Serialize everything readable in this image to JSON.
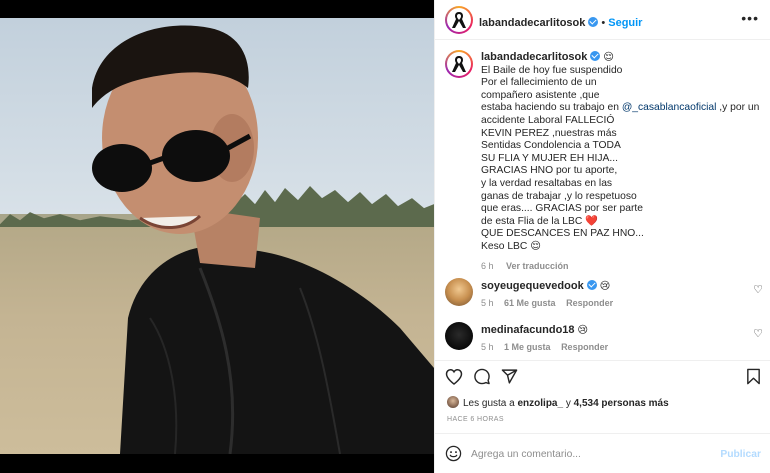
{
  "post": {
    "author": "labandadecarlitosok",
    "follow_label": "Seguir",
    "more_label": "•••",
    "caption_emoji": "😌",
    "caption_lines": [
      "El Baile de hoy fue suspendido",
      "Por el fallecimiento de un",
      "compañero asistente ,que",
      "estaba haciendo su trabajo en ",
      "accidente Laboral FALLECIÓ",
      "KEVIN PEREZ ,nuestras más",
      "Sentidas Condolencia a TODA",
      "SU FLIA Y MUJER EH HIJA...",
      "GRACIAS HNO por tu aporte,",
      "y la verdad resaltabas en las",
      "ganas de trabajar ,y lo respetuoso",
      "que eras.... GRACIAS por ser parte",
      "de esta Flia de la LBC ❤️",
      "QUE DESCANCES EN PAZ HNO...",
      "Keso LBC 😌"
    ],
    "caption_mention": "@_casablancaoficial",
    "caption_after_mention": " ,y por un",
    "caption_time": "6 h",
    "translate_label": "Ver traducción"
  },
  "comments": [
    {
      "user": "soyeugequevedook",
      "verified": true,
      "text": "😢",
      "time": "5 h",
      "likes": "61 Me gusta",
      "reply": "Responder"
    },
    {
      "user": "medinafacundo18",
      "verified": false,
      "text": "😢",
      "time": "5 h",
      "likes": "1 Me gusta",
      "reply": "Responder"
    }
  ],
  "likes": {
    "prefix": "Les gusta a ",
    "user": "enzolipa_",
    "middle": " y ",
    "count": "4,534 personas más"
  },
  "timestamp": "HACE 6 HORAS",
  "add_comment": {
    "placeholder": "Agrega un comentario...",
    "publish_label": "Publicar"
  },
  "colors": {
    "link": "#0095f6",
    "verified": "#3897f0",
    "text": "#262626",
    "muted": "#8e8e8e"
  },
  "icons": [
    "ribbon-icon",
    "heart-icon",
    "comment-icon",
    "share-icon",
    "bookmark-icon",
    "emoji-icon"
  ]
}
